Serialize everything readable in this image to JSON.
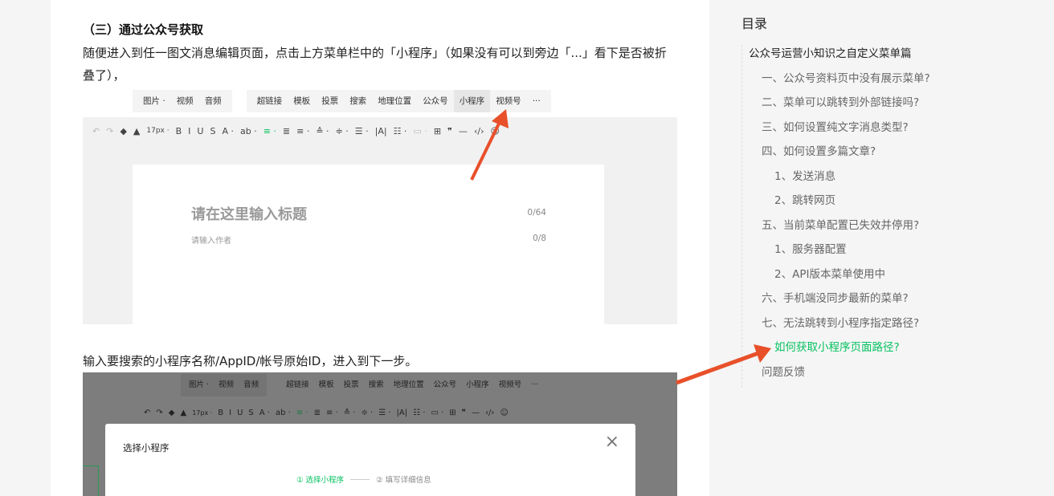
{
  "article": {
    "section_title": "（三）通过公众号获取",
    "paragraph1": "随便进入到任一图文消息编辑页面，点击上方菜单栏中的「小程序」（如果没有可以到旁边「...」看下是否被折叠了），",
    "paragraph2": "输入要搜索的小程序名称/AppID/帐号原始ID，进入到下一步。"
  },
  "editor_screenshot": {
    "tabs_group1": [
      "图片 ·",
      "视频",
      "音频"
    ],
    "tabs_group2": [
      "超链接",
      "模板",
      "投票",
      "搜索",
      "地理位置",
      "公众号",
      "小程序",
      "视频号",
      "···"
    ],
    "active_tab": "小程序",
    "toolbar": {
      "undo": "↶",
      "redo": "↷",
      "font_size": "17px ·",
      "bold": "B",
      "italic": "I",
      "underline": "U",
      "strike": "S",
      "color": "A ·",
      "bg": "ab ·",
      "table": "⊞",
      "quote": "❞",
      "hr": "—",
      "code": "‹/›",
      "emoji": "☺"
    },
    "title_placeholder": "请在这里输入标题",
    "title_count": "0/64",
    "author_placeholder": "请输入作者",
    "author_count": "0/8"
  },
  "dialog_screenshot": {
    "tabs_group1": [
      "图片 ·",
      "视频",
      "音频"
    ],
    "tabs_group2": [
      "超链接",
      "模板",
      "投票",
      "搜索",
      "地理位置",
      "公众号",
      "小程序",
      "视频号",
      "···"
    ],
    "dialog_title": "选择小程序",
    "close": "×",
    "step1": "① 选择小程序",
    "step2": "② 填写详细信息"
  },
  "toc": {
    "title": "目录",
    "items": [
      {
        "label": "公众号运营小知识之自定义菜单篇",
        "level": 0
      },
      {
        "label": "一、公众号资料页中没有展示菜单?",
        "level": 1
      },
      {
        "label": "二、菜单可以跳转到外部链接吗?",
        "level": 1
      },
      {
        "label": "三、如何设置纯文字消息类型?",
        "level": 1
      },
      {
        "label": "四、如何设置多篇文章?",
        "level": 1
      },
      {
        "label": "1、发送消息",
        "level": 2
      },
      {
        "label": "2、跳转网页",
        "level": 2
      },
      {
        "label": "五、当前菜单配置已失效并停用?",
        "level": 1
      },
      {
        "label": "1、服务器配置",
        "level": 2
      },
      {
        "label": "2、API版本菜单使用中",
        "level": 2
      },
      {
        "label": "六、手机端没同步最新的菜单?",
        "level": 1
      },
      {
        "label": "七、无法跳转到小程序指定路径?",
        "level": 1
      },
      {
        "label": "如何获取小程序页面路径?",
        "level": 2,
        "active": true
      },
      {
        "label": "问题反馈",
        "level": 1
      }
    ]
  },
  "colors": {
    "accent_green": "#07c160",
    "arrow_red": "#e8502a"
  }
}
